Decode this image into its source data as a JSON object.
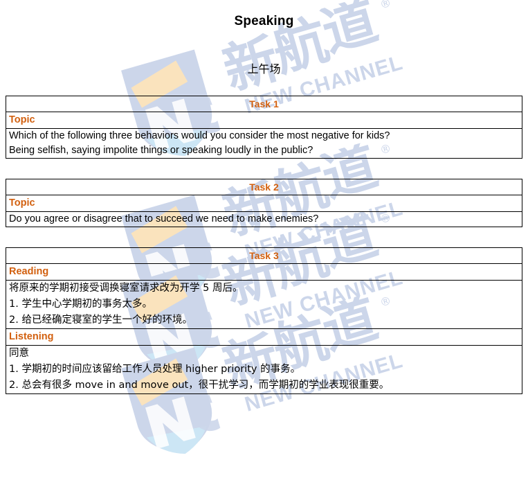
{
  "document": {
    "title": "Speaking",
    "session": "上午场"
  },
  "watermark": {
    "brand_cn": "新航道",
    "brand_en": "NEW CHANNEL",
    "mark_letters": "NC",
    "registered_mark": "®",
    "color_blue": "#ccd6ea",
    "color_gold": "#fae3bd",
    "color_cyan": "#cce6f5"
  },
  "colors": {
    "heading_orange": "#D2600F",
    "body_black": "#000000",
    "border_black": "#000000",
    "page_background": "#FFFFFF"
  },
  "tasks": [
    {
      "header": "Task 1",
      "sections": [
        {
          "label": "Topic",
          "lines": [
            "Which of the following three behaviors would you consider the most negative for kids?",
            "Being selfish, saying impolite things or speaking loudly in the public?"
          ],
          "lang": "en"
        }
      ]
    },
    {
      "header": "Task 2",
      "sections": [
        {
          "label": "Topic",
          "lines": [
            "Do you agree or disagree that to succeed we need to make enemies?"
          ],
          "lang": "en"
        }
      ]
    },
    {
      "header": "Task 3",
      "sections": [
        {
          "label": "Reading",
          "lines": [
            "将原来的学期初接受调换寝室请求改为开学 5 周后。",
            "1. 学生中心学期初的事务太多。",
            "2. 给已经确定寝室的学生一个好的环境。"
          ],
          "lang": "cn"
        },
        {
          "label": "Listening",
          "lines": [
            "同意",
            "1. 学期初的时间应该留给工作人员处理 higher priority 的事务。",
            "2. 总会有很多 move in and move out，很干扰学习，而学期初的学业表现很重要。"
          ],
          "lang": "cn"
        }
      ]
    }
  ]
}
